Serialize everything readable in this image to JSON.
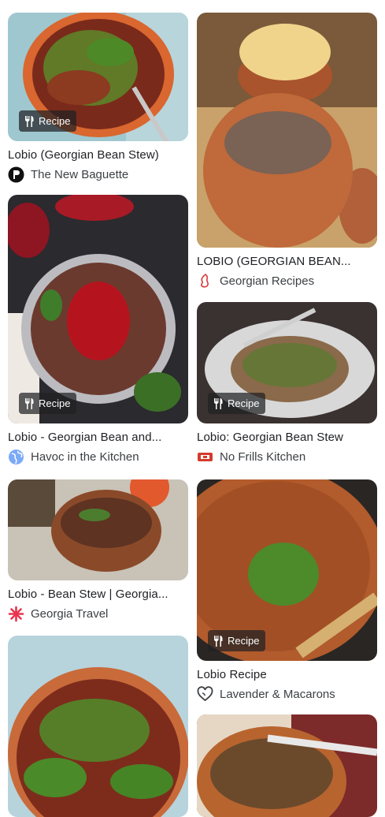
{
  "badge_label": "Recipe",
  "cards": {
    "c1": {
      "title": "Lobio (Georgian Bean Stew)",
      "source": "The New Baguette",
      "favicon": "baguette-logo-icon"
    },
    "c2": {
      "title": "LOBIO (GEORGIAN BEAN...",
      "source": "Georgian Recipes",
      "favicon": "georgian-recipes-logo-icon"
    },
    "c3": {
      "title": "Lobio - Georgian Bean and...",
      "source": "Havoc in the Kitchen",
      "favicon": "globe-icon"
    },
    "c4": {
      "title": "Lobio: Georgian Bean Stew",
      "source": "No Frills Kitchen",
      "favicon": "no-frills-logo-icon"
    },
    "c5": {
      "title": "Lobio - Bean Stew | Georgia...",
      "source": "Georgia Travel",
      "favicon": "georgia-travel-logo-icon"
    },
    "c6": {
      "title": "Lobio Recipe",
      "source": "Lavender & Macarons",
      "favicon": "heart-logo-icon"
    },
    "c7": {
      "title": "",
      "source": ""
    },
    "c8": {
      "title": "",
      "source": ""
    }
  }
}
